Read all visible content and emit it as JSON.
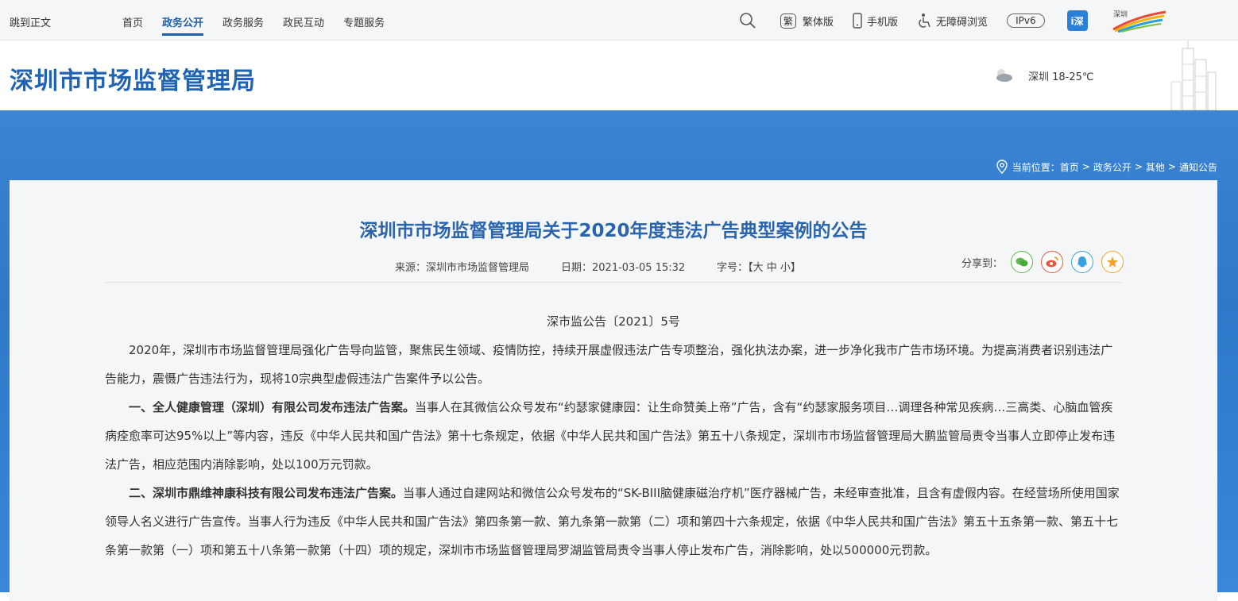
{
  "topbar": {
    "skip": "跳到正文",
    "nav": [
      "首页",
      "政务公开",
      "政务服务",
      "政民互动",
      "专题服务"
    ],
    "active_index": 1,
    "traditional_badge": "繁",
    "traditional": "繁体版",
    "mobile": "手机版",
    "accessibility": "无障碍浏览",
    "ipv6": "IPv6",
    "tianyi_badge": "i深",
    "city_logo_text": "深圳"
  },
  "header": {
    "site_title": "深圳市市场监督管理局",
    "weather": "深圳 18-25℃"
  },
  "breadcrumb": {
    "prefix": "当前位置：",
    "items": [
      "首页",
      "政务公开",
      "其他",
      "通知公告"
    ],
    "separator": ">"
  },
  "article": {
    "title": "深圳市市场监督管理局关于2020年度违法广告典型案例的公告",
    "source": "来源：深圳市市场监督管理局",
    "date": "日期：2021-03-05 15:32",
    "fontsize_label": "字号：【大  中  小】",
    "share_label": "分享到：",
    "doc_no": "深市监公告〔2021〕5号",
    "p1": "2020年，深圳市市场监督管理局强化广告导向监管，聚焦民生领域、疫情防控，持续开展虚假违法广告专项整治，强化执法办案，进一步净化我市广告市场环境。为提高消费者识别违法广告能力，震慑广告违法行为，现将10宗典型虚假违法广告案件予以公告。",
    "c1_head": "一、全人健康管理（深圳）有限公司发布违法广告案。",
    "c1_body": "当事人在其微信公众号发布“约瑟家健康园：让生命赞美上帝”广告，含有“约瑟家服务项目…调理各种常见疾病…三高类、心脑血管疾病痊愈率可达95%以上”等内容，违反《中华人民共和国广告法》第十七条规定，依据《中华人民共和国广告法》第五十八条规定，深圳市市场监督管理局大鹏监管局责令当事人立即停止发布违法广告，相应范围内消除影响，处以100万元罚款。",
    "c2_head": "二、深圳市鼎维神康科技有限公司发布违法广告案。",
    "c2_body": "当事人通过自建网站和微信公众号发布的“SK-BIII脑健康磁治疗机”医疗器械广告，未经审查批准，且含有虚假内容。在经营场所使用国家领导人名义进行广告宣传。当事人行为违反《中华人民共和国广告法》第四条第一款、第九条第一款第（二）项和第四十六条规定，依据《中华人民共和国广告法》第五十五条第一款、第五十七条第一款第（一）项和第五十八条第一款第（十四）项的规定，深圳市市场监督管理局罗湖监管局责令当事人停止发布广告，消除影响，处以500000元罚款。"
  },
  "colors": {
    "brand_blue": "#2063b3",
    "band_blue": "#3580d0",
    "card_bg": "#f5f6f8"
  },
  "icons": [
    "search-icon",
    "phone-icon",
    "accessibility-icon",
    "weather-icon",
    "location-icon",
    "wechat-icon",
    "weibo-icon",
    "qq-icon",
    "favorite-icon"
  ]
}
